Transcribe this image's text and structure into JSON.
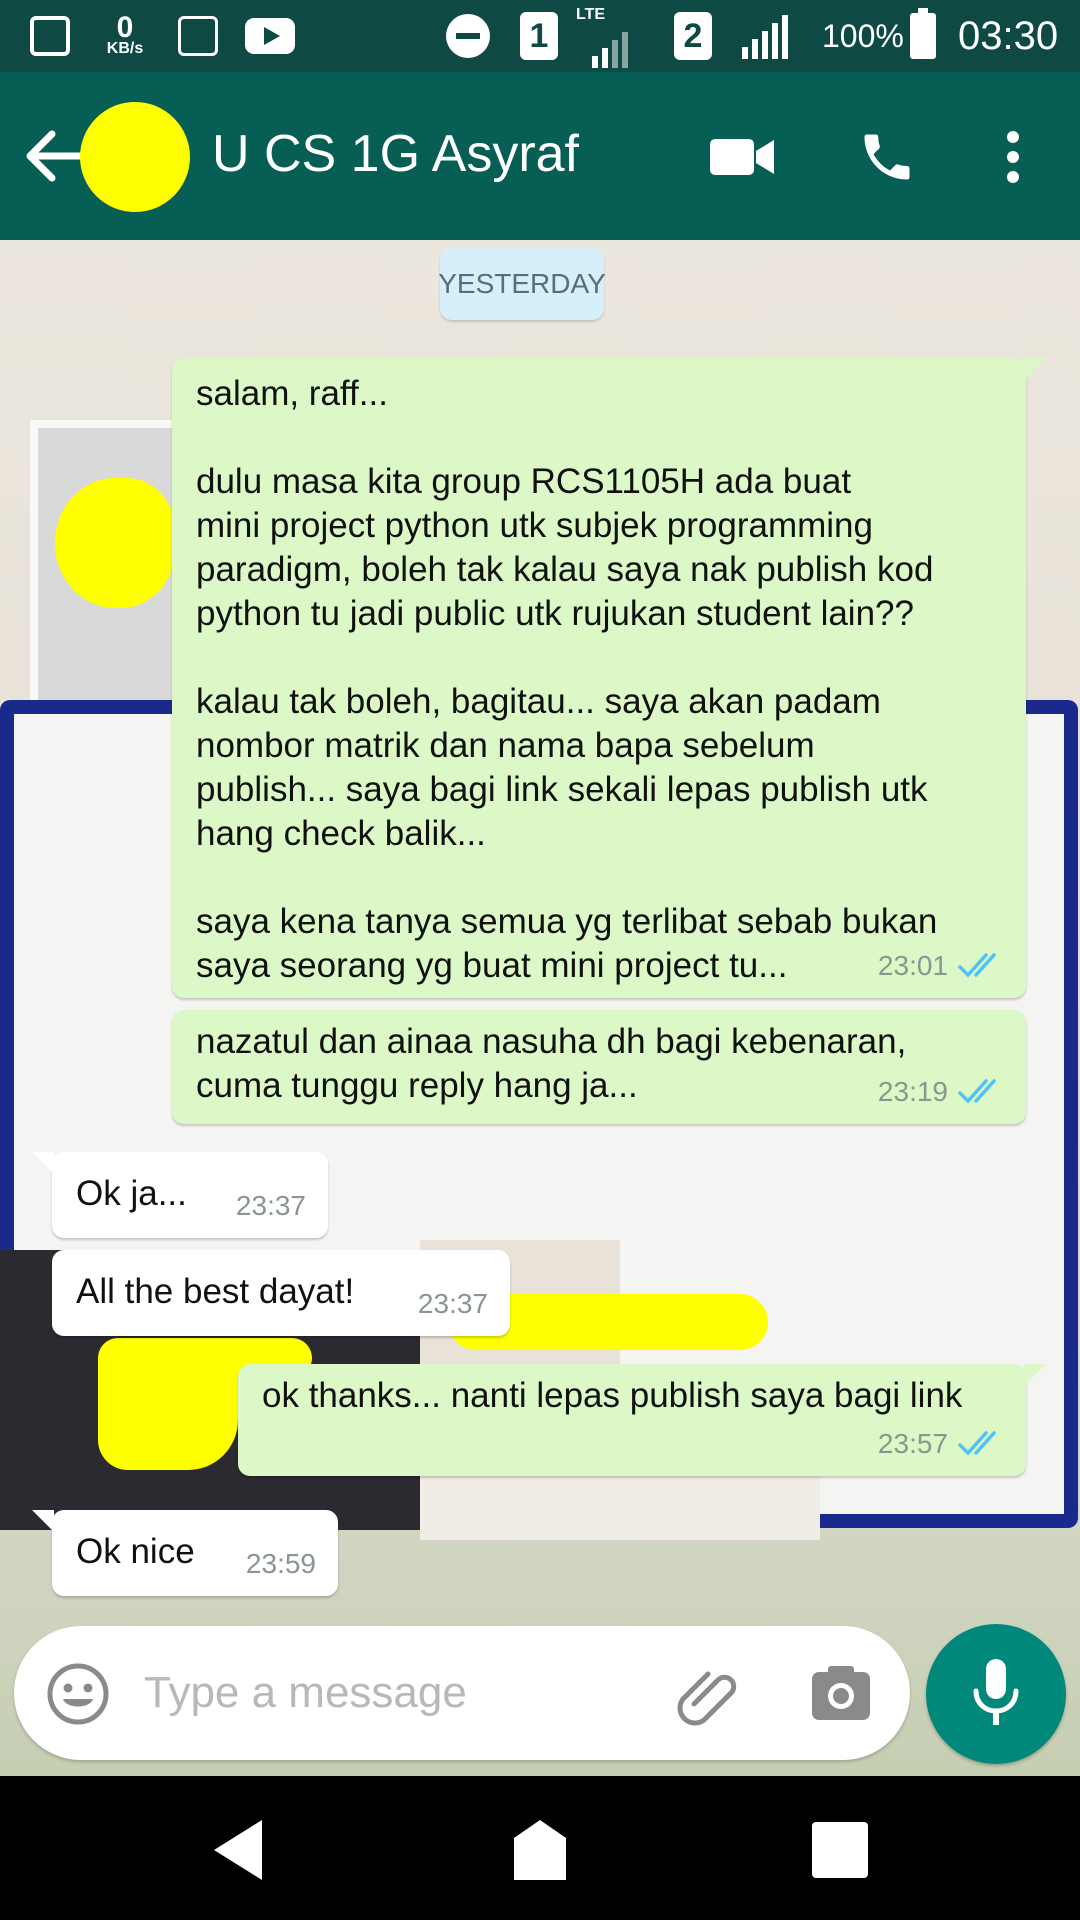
{
  "status_bar": {
    "net_speed_value": "0",
    "net_speed_unit": "KB/s",
    "network_type": "LTE",
    "sim1_label": "1",
    "sim2_label": "2",
    "battery": "100%",
    "time": "03:30"
  },
  "header": {
    "contact_name": "U CS 1G Asyraf",
    "icons": [
      "back-arrow-icon",
      "video-call-icon",
      "voice-call-icon",
      "more-options-icon"
    ]
  },
  "chat": {
    "date_label": "YESTERDAY",
    "messages": [
      {
        "direction": "outgoing",
        "text": "salam, raff...\n\ndulu masa kita group RCS1105H ada buat\nmini project python utk subjek programming\nparadigm, boleh tak kalau saya nak publish kod\npython tu jadi public utk rujukan student lain??\n\nkalau tak boleh, bagitau... saya akan padam\nnombor matrik dan nama bapa sebelum\npublish... saya bagi link sekali lepas publish utk\nhang check balik...\n\nsaya kena tanya semua yg terlibat sebab bukan\nsaya seorang yg buat mini project tu...",
        "time": "23:01",
        "status": "read"
      },
      {
        "direction": "outgoing",
        "text": "nazatul dan ainaa nasuha dh bagi kebenaran,\ncuma tunggu reply hang ja...",
        "time": "23:19",
        "status": "read"
      },
      {
        "direction": "incoming",
        "text": "Ok ja...",
        "time": "23:37"
      },
      {
        "direction": "incoming",
        "text": "All the best dayat!",
        "time": "23:37"
      },
      {
        "direction": "outgoing",
        "text": "ok thanks... nanti lepas publish saya bagi link",
        "time": "23:57",
        "status": "read"
      },
      {
        "direction": "incoming",
        "text": "Ok nice",
        "time": "23:59"
      }
    ]
  },
  "composer": {
    "placeholder": "Type a message"
  },
  "colors": {
    "status_bar": "#0e4a43",
    "app_bar": "#075e54",
    "outgoing_bubble": "#dcf8c6",
    "incoming_bubble": "#ffffff",
    "read_ticks": "#4fc3f7",
    "mic_button": "#00897b",
    "redaction": "#ffff00"
  }
}
